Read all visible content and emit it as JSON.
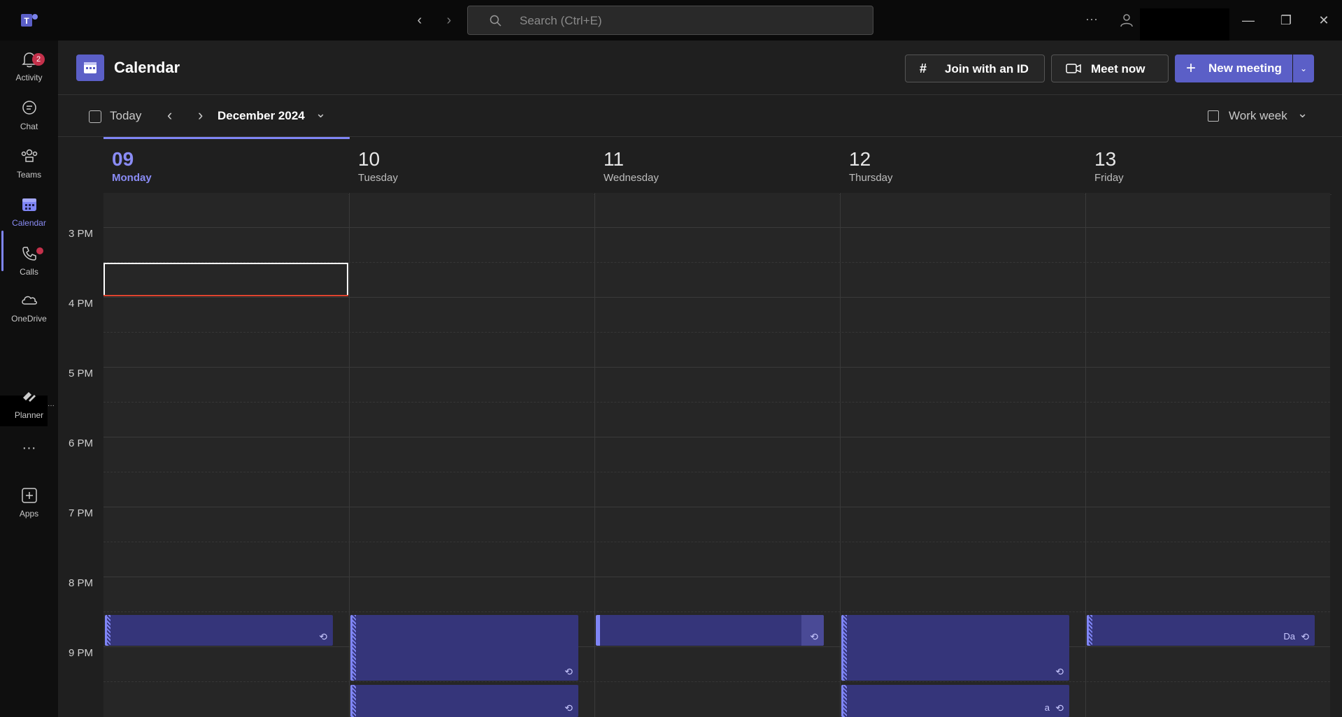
{
  "search": {
    "placeholder": "Search (Ctrl+E)"
  },
  "rail": {
    "items": [
      {
        "label": "Activity",
        "badge": "2"
      },
      {
        "label": "Chat"
      },
      {
        "label": "Teams"
      },
      {
        "label": "Calendar",
        "active": true
      },
      {
        "label": "Calls"
      },
      {
        "label": "OneDrive"
      },
      {
        "label": "Planner"
      },
      {
        "label": "Apps"
      }
    ]
  },
  "header": {
    "title": "Calendar",
    "join_label": "Join with an ID",
    "meet_label": "Meet now",
    "new_label": "New meeting"
  },
  "toolbar": {
    "today_label": "Today",
    "month_label": "December 2024",
    "view_label": "Work week"
  },
  "days": [
    {
      "num": "09",
      "name": "Monday",
      "today": true
    },
    {
      "num": "10",
      "name": "Tuesday"
    },
    {
      "num": "11",
      "name": "Wednesday"
    },
    {
      "num": "12",
      "name": "Thursday"
    },
    {
      "num": "13",
      "name": "Friday"
    }
  ],
  "times": [
    "3 PM",
    "4 PM",
    "5 PM",
    "6 PM",
    "7 PM",
    "8 PM",
    "9 PM"
  ],
  "events": {
    "fri_text": "Da",
    "thu_text": "a"
  },
  "colors": {
    "accent": "#5b5fc7",
    "event_bg": "#35357a",
    "now_line": "#e0442f"
  }
}
